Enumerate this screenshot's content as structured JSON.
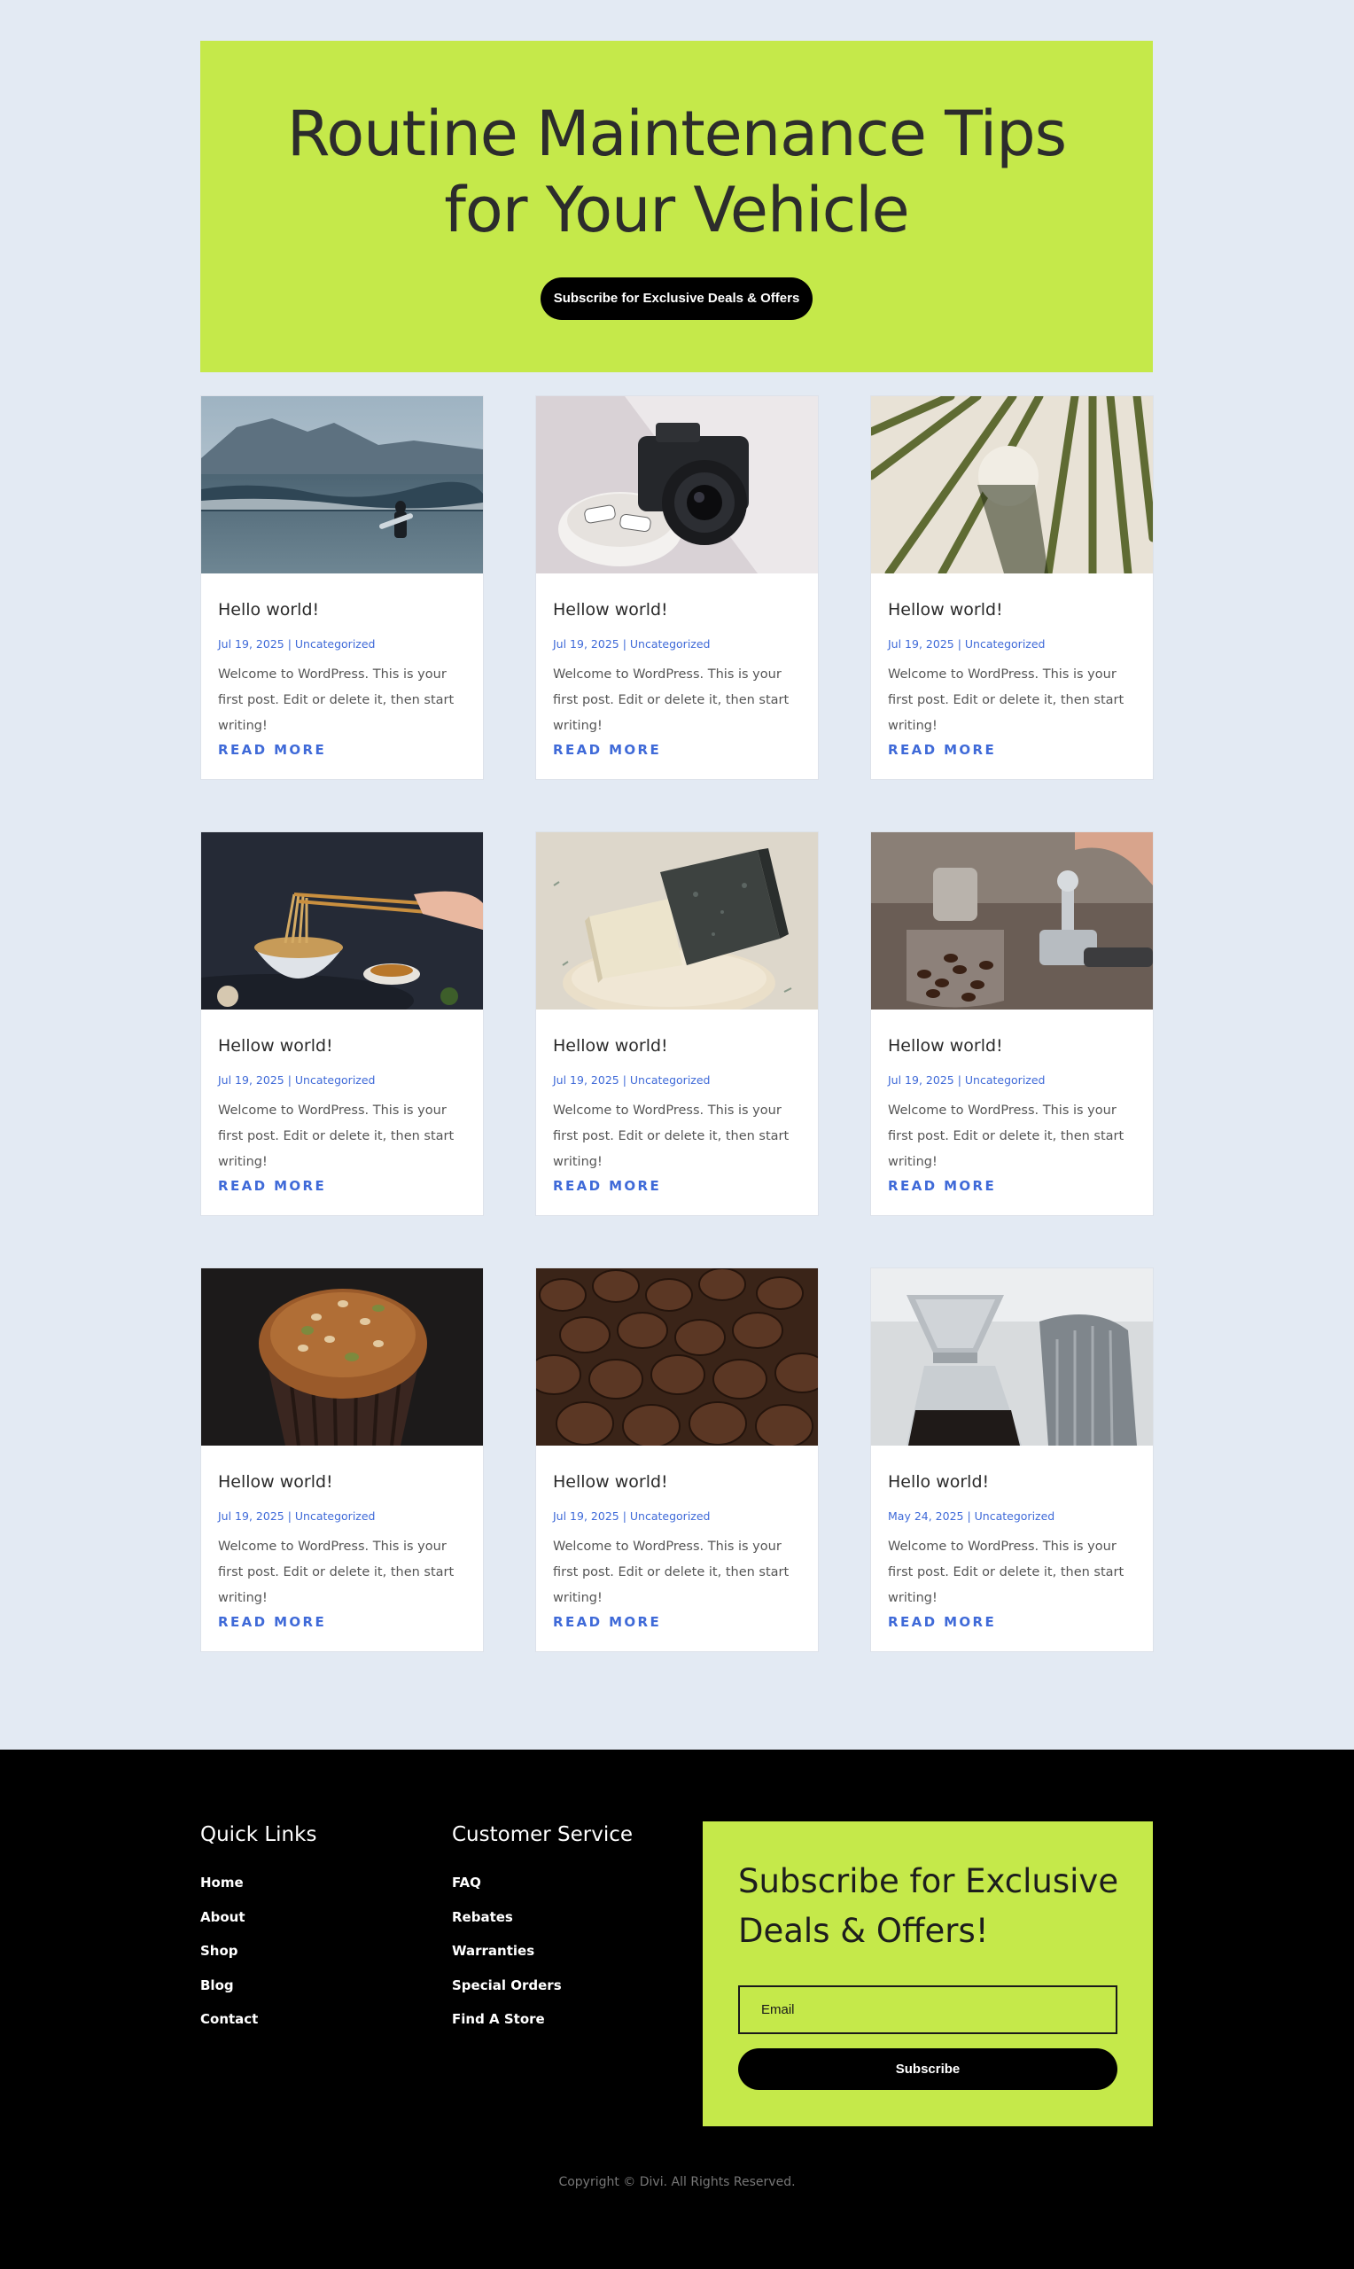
{
  "hero": {
    "title": "Routine Maintenance Tips for Your Vehicle",
    "button_label": "Subscribe for Exclusive Deals & Offers"
  },
  "posts": [
    {
      "title": "Hello world!",
      "date": "Jul 19, 2025",
      "category": "Uncategorized",
      "excerpt": "Welcome to WordPress. This is your first post. Edit or delete it, then start writing!",
      "read_more": "READ MORE",
      "image": "surfer-photo"
    },
    {
      "title": "Hellow world!",
      "date": "Jul 19, 2025",
      "category": "Uncategorized",
      "excerpt": "Welcome to WordPress. This is your first post. Edit or delete it, then start writing!",
      "read_more": "READ MORE",
      "image": "camera-photo"
    },
    {
      "title": "Hellow world!",
      "date": "Jul 19, 2025",
      "category": "Uncategorized",
      "excerpt": "Welcome to WordPress. This is your first post. Edit or delete it, then start writing!",
      "read_more": "READ MORE",
      "image": "palm-leaf-photo"
    },
    {
      "title": "Hellow world!",
      "date": "Jul 19, 2025",
      "category": "Uncategorized",
      "excerpt": "Welcome to WordPress. This is your first post. Edit or delete it, then start writing!",
      "read_more": "READ MORE",
      "image": "noodles-photo"
    },
    {
      "title": "Hellow world!",
      "date": "Jul 19, 2025",
      "category": "Uncategorized",
      "excerpt": "Welcome to WordPress. This is your first post. Edit or delete it, then start writing!",
      "read_more": "READ MORE",
      "image": "soap-photo"
    },
    {
      "title": "Hellow world!",
      "date": "Jul 19, 2025",
      "category": "Uncategorized",
      "excerpt": "Welcome to WordPress. This is your first post. Edit or delete it, then start writing!",
      "read_more": "READ MORE",
      "image": "espresso-photo"
    },
    {
      "title": "Hellow world!",
      "date": "Jul 19, 2025",
      "category": "Uncategorized",
      "excerpt": "Welcome to WordPress. This is your first post. Edit or delete it, then start writing!",
      "read_more": "READ MORE",
      "image": "muffin-photo"
    },
    {
      "title": "Hellow world!",
      "date": "Jul 19, 2025",
      "category": "Uncategorized",
      "excerpt": "Welcome to WordPress. This is your first post. Edit or delete it, then start writing!",
      "read_more": "READ MORE",
      "image": "coffee-beans-photo"
    },
    {
      "title": "Hello world!",
      "date": "May 24, 2025",
      "category": "Uncategorized",
      "excerpt": "Welcome to WordPress. This is your first post. Edit or delete it, then start writing!",
      "read_more": "READ MORE",
      "image": "pour-over-photo"
    }
  ],
  "footer": {
    "quick_links": {
      "heading": "Quick Links",
      "items": [
        "Home",
        "About",
        "Shop",
        "Blog",
        "Contact"
      ]
    },
    "customer_service": {
      "heading": "Customer Service",
      "items": [
        "FAQ",
        "Rebates",
        "Warranties",
        "Special Orders",
        "Find A Store"
      ]
    },
    "subscribe": {
      "title": "Subscribe for Exclusive Deals & Offers!",
      "email_placeholder": "Email",
      "button_label": "Subscribe"
    },
    "copyright": "Copyright © Divi. All Rights Reserved."
  },
  "colors": {
    "page_bg": "#e3eaf3",
    "accent_lime": "#c5e94a",
    "link_blue": "#3f6ad8",
    "footer_bg": "#000000"
  }
}
